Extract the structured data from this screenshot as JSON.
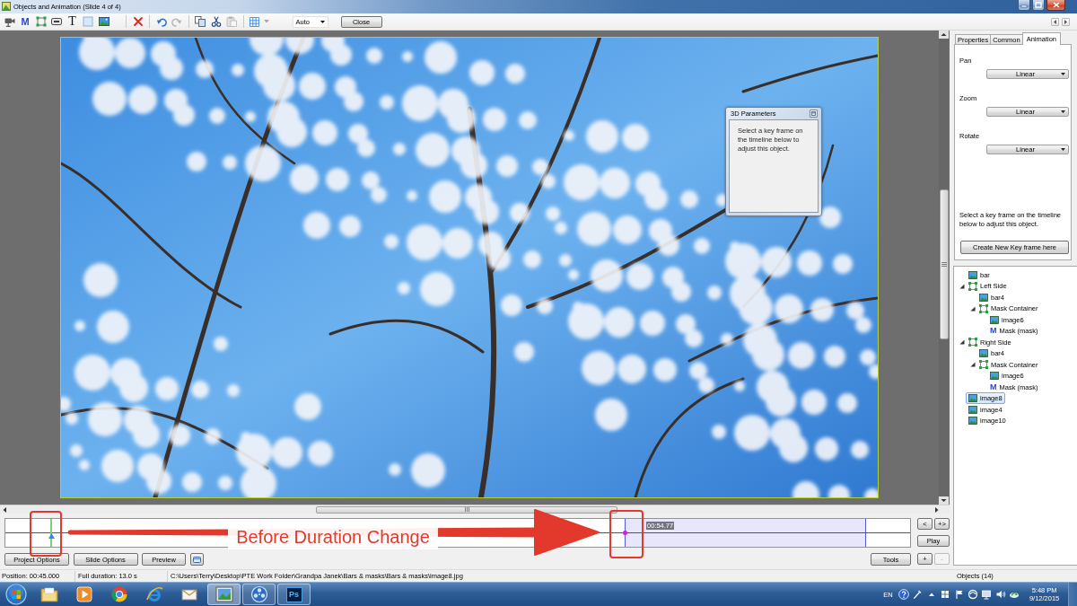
{
  "window": {
    "title": "Objects and Animation (Slide 4 of 4)"
  },
  "toolbar": {
    "groups": [
      {
        "tools": [
          {
            "kind": "video",
            "disabled": false
          },
          {
            "kind": "mask",
            "label": "M",
            "disabled": false
          },
          {
            "kind": "frame",
            "disabled": false
          },
          {
            "kind": "button",
            "disabled": false
          },
          {
            "kind": "text",
            "label": "T",
            "disabled": false
          },
          {
            "kind": "rectangle",
            "disabled": false
          },
          {
            "kind": "image",
            "disabled": false
          }
        ]
      },
      {
        "tools": [
          {
            "kind": "delete",
            "disabled": false
          }
        ]
      },
      {
        "tools": [
          {
            "kind": "undo",
            "disabled": false
          },
          {
            "kind": "redo",
            "disabled": true
          }
        ]
      },
      {
        "tools": [
          {
            "kind": "copy",
            "disabled": false
          },
          {
            "kind": "cut",
            "disabled": false
          },
          {
            "kind": "paste",
            "disabled": true
          }
        ]
      },
      {
        "tools": [
          {
            "kind": "grid",
            "disabled": false
          }
        ]
      }
    ],
    "dropdown": {
      "value": "Auto"
    },
    "close_button": "Close"
  },
  "stage": {
    "dialog": {
      "title": "3D Parameters",
      "message": "Select a key frame on the timeline below to adjust this object."
    }
  },
  "properties_panel": {
    "tabs": [
      {
        "label": "Properties",
        "selected": false
      },
      {
        "label": "Common",
        "selected": false
      },
      {
        "label": "Animation",
        "selected": true
      }
    ],
    "fields": [
      {
        "label": "Pan",
        "value": "Linear"
      },
      {
        "label": "Zoom",
        "value": "Linear"
      },
      {
        "label": "Rotate",
        "value": "Linear"
      }
    ],
    "hint": "Select a key frame on the timeline below to adjust this object.",
    "button": "Create New Key frame here"
  },
  "object_tree": {
    "items": [
      {
        "kind": "image",
        "label": "bar",
        "selected": false
      },
      {
        "kind": "frame",
        "label": "Left Side",
        "selected": false,
        "expanded": true,
        "children": [
          {
            "kind": "image",
            "label": "bar4",
            "selected": false
          },
          {
            "kind": "frame",
            "label": "Mask Container",
            "selected": false,
            "expanded": true,
            "children": [
              {
                "kind": "image",
                "label": "image6",
                "selected": false
              },
              {
                "kind": "mask",
                "glyph": "M",
                "label": "Mask (mask)",
                "selected": false
              }
            ]
          }
        ]
      },
      {
        "kind": "frame",
        "label": "Right Side",
        "selected": false,
        "expanded": true,
        "children": [
          {
            "kind": "image",
            "label": "bar4",
            "selected": false
          },
          {
            "kind": "frame",
            "label": "Mask Container",
            "selected": false,
            "expanded": true,
            "children": [
              {
                "kind": "image",
                "label": "image6",
                "selected": false
              },
              {
                "kind": "mask",
                "glyph": "M",
                "label": "Mask (mask)",
                "selected": false
              }
            ]
          }
        ]
      },
      {
        "kind": "image",
        "label": "image8",
        "selected": true
      },
      {
        "kind": "image",
        "label": "image4",
        "selected": false
      },
      {
        "kind": "image",
        "label": "image10",
        "selected": false
      }
    ]
  },
  "timeline": {
    "keyframe_time": "00:54.77",
    "nav_buttons": [
      {
        "label": "<",
        "disabled": false
      },
      {
        "label": "+>",
        "disabled": false
      }
    ],
    "play_button": "Play",
    "keyframe_buttons": [
      {
        "label": "+",
        "disabled": false
      },
      {
        "label": "-",
        "disabled": true
      }
    ],
    "option_buttons": [
      "Project Options",
      "Slide Options",
      "Preview"
    ],
    "tools_button": "Tools"
  },
  "status_bar": {
    "position": "Position: 00:45.000",
    "duration": "Full duration: 13.0 s",
    "file_path": "C:\\Users\\Terry\\Desktop\\PTE Work Folder\\Grandpa Janek\\Bars & masks\\Bars & masks\\image8.jpg",
    "object_count": "Objects (14)"
  },
  "taskbar": {
    "apps": [
      {
        "kind": "folder",
        "running": false,
        "selected": false
      },
      {
        "kind": "player",
        "running": false,
        "selected": false
      },
      {
        "kind": "sphere",
        "running": false,
        "selected": false
      },
      {
        "kind": "ring",
        "running": false,
        "selected": false
      },
      {
        "kind": "mail",
        "running": false,
        "selected": false
      },
      {
        "kind": "editor",
        "running": true,
        "selected": true
      },
      {
        "kind": "reel",
        "running": true,
        "selected": false
      },
      {
        "kind": "tile",
        "label": "Ps",
        "running": true,
        "selected": false
      }
    ],
    "tray": {
      "language": "EN",
      "time": "5:48 PM",
      "date": "9/12/2015"
    }
  },
  "annotation": {
    "caption": "Before Duration Change"
  }
}
